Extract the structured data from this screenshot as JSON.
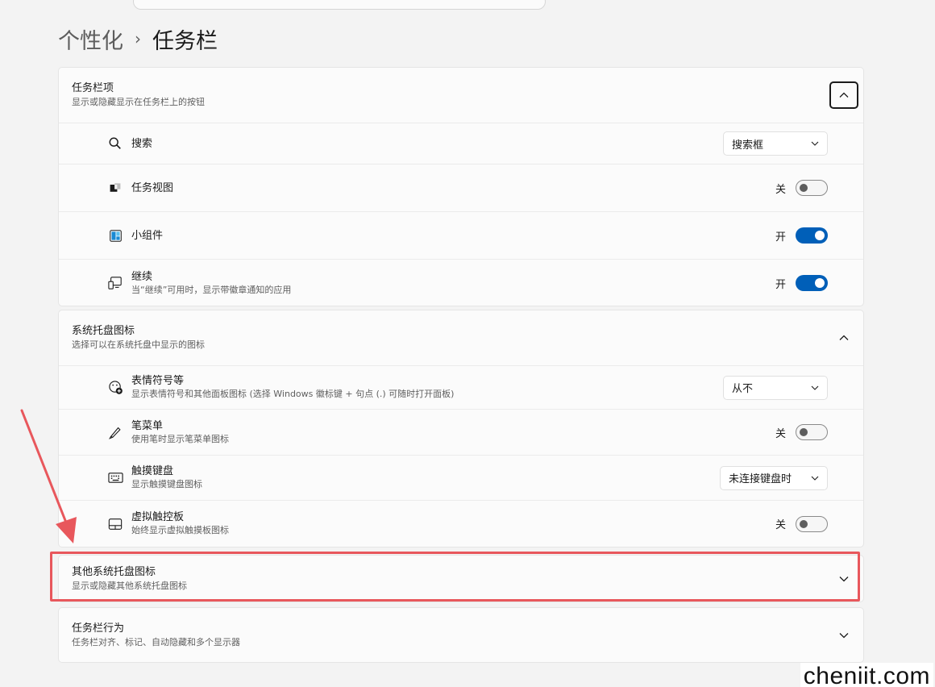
{
  "breadcrumb": {
    "parent": "个性化",
    "separator": "›",
    "current": "任务栏"
  },
  "taskbar_items": {
    "title": "任务栏项",
    "desc": "显示或隐藏显示在任务栏上的按钮",
    "rows": [
      {
        "icon": "search-icon",
        "title": "搜索",
        "control": "dropdown",
        "value": "搜索框"
      },
      {
        "icon": "task-view-icon",
        "title": "任务视图",
        "control": "toggle",
        "state": "off",
        "state_label": "关"
      },
      {
        "icon": "widgets-icon",
        "title": "小组件",
        "control": "toggle",
        "state": "on",
        "state_label": "开"
      },
      {
        "icon": "continue-icon",
        "title": "继续",
        "desc": "当“继续”可用时，显示带徽章通知的应用",
        "control": "toggle",
        "state": "on",
        "state_label": "开"
      }
    ]
  },
  "system_tray": {
    "title": "系统托盘图标",
    "desc": "选择可以在系统托盘中显示的图标",
    "rows": [
      {
        "icon": "emoji-icon",
        "title": "表情符号等",
        "desc": "显示表情符号和其他面板图标 (选择 Windows 徽标键 + 句点 (.) 可随时打开面板)",
        "control": "dropdown",
        "value": "从不"
      },
      {
        "icon": "pen-icon",
        "title": "笔菜单",
        "desc": "使用笔时显示笔菜单图标",
        "control": "toggle",
        "state": "off",
        "state_label": "关"
      },
      {
        "icon": "keyboard-icon",
        "title": "触摸键盘",
        "desc": "显示触摸键盘图标",
        "control": "dropdown",
        "value": "未连接键盘时"
      },
      {
        "icon": "touchpad-icon",
        "title": "虚拟触控板",
        "desc": "始终显示虚拟触摸板图标",
        "control": "toggle",
        "state": "off",
        "state_label": "关"
      }
    ]
  },
  "other_tray": {
    "title": "其他系统托盘图标",
    "desc": "显示或隐藏其他系统托盘图标"
  },
  "taskbar_behaviors": {
    "title": "任务栏行为",
    "desc": "任务栏对齐、标记、自动隐藏和多个显示器"
  },
  "watermark": "cheniit.com",
  "colors": {
    "accent": "#005fb8",
    "highlight": "#e8575c"
  }
}
